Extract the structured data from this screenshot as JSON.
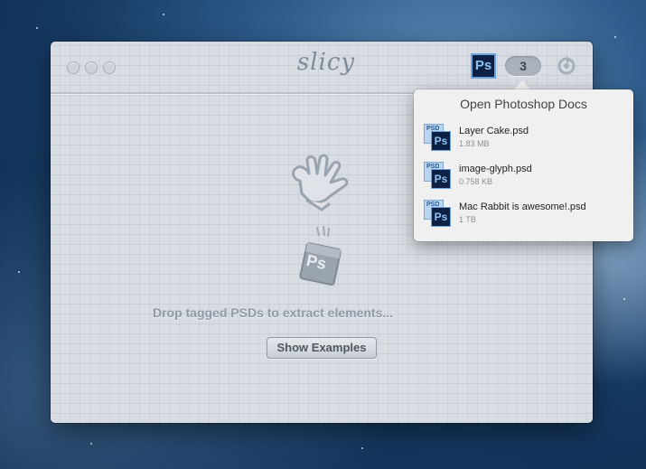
{
  "app": {
    "logo_text": "slicy"
  },
  "toolbar": {
    "ps_badge": "Ps",
    "open_count": "3"
  },
  "popover": {
    "title": "Open Photoshop Docs",
    "docs": [
      {
        "name": "Layer Cake.psd",
        "size": "1.83 MB",
        "icon_tag": "PSD",
        "icon_label": "Ps"
      },
      {
        "name": "image-glyph.psd",
        "size": "0.758 KB",
        "icon_tag": "PSD",
        "icon_label": "Ps"
      },
      {
        "name": "Mac Rabbit is awesome!.psd",
        "size": "1 TB",
        "icon_tag": "PSD",
        "icon_label": "Ps"
      }
    ]
  },
  "main": {
    "drop_hint": "Drop tagged PSDs to extract elements...",
    "drop_icon_label": "Ps",
    "examples_button": "Show Examples"
  },
  "colors": {
    "window_bg": "#d8dde3",
    "ps_navy": "#0e2144",
    "ps_blue": "#6da4e0",
    "muted_text": "#8f9aa6"
  },
  "icons": {
    "close": "traffic-light-close",
    "minimize": "traffic-light-minimize",
    "zoom": "traffic-light-zoom",
    "refresh": "refresh-icon",
    "hand": "glove-hand-icon",
    "drop_file": "psd-file-icon"
  }
}
